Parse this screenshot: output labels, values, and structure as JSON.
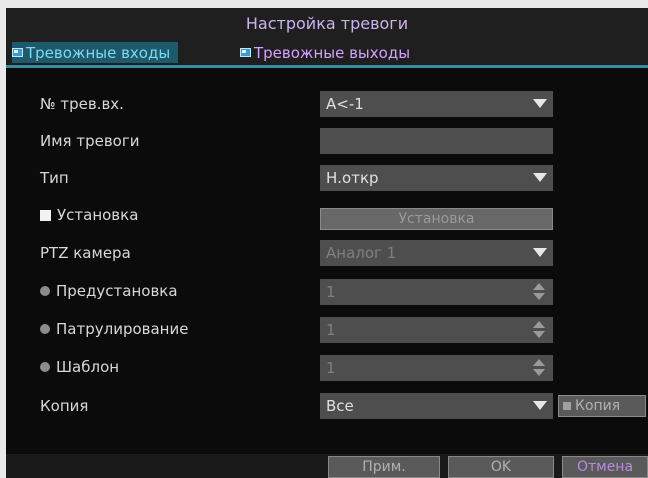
{
  "window": {
    "title": "Настройка тревоги"
  },
  "tabs": [
    {
      "label": "Тревожные входы"
    },
    {
      "label": "Тревожные выходы"
    }
  ],
  "form": {
    "alarm_input_no": {
      "label": "№ трев.вх.",
      "value": "A<-1"
    },
    "alarm_name": {
      "label": "Имя тревоги",
      "value": ""
    },
    "type": {
      "label": "Тип",
      "value": "Н.откр"
    },
    "setup": {
      "label": "Установка",
      "button_label": "Установка"
    },
    "ptz_camera": {
      "label": "PTZ камера",
      "value": "Аналог 1"
    },
    "preset": {
      "label": "Предустановка",
      "value": "1"
    },
    "patrol": {
      "label": "Патрулирование",
      "value": "1"
    },
    "pattern": {
      "label": "Шаблон",
      "value": "1"
    },
    "copy": {
      "label": "Копия",
      "value": "Все",
      "button_label": "Копия"
    }
  },
  "buttons": {
    "apply_label": "Прим.",
    "ok_label": "OK",
    "cancel_label": "Отмена"
  },
  "colors": {
    "frame": "#0b0b0b",
    "tab_active": "#1d5a6c",
    "title": "#c9b4f0",
    "field": "#4e4e4e"
  }
}
